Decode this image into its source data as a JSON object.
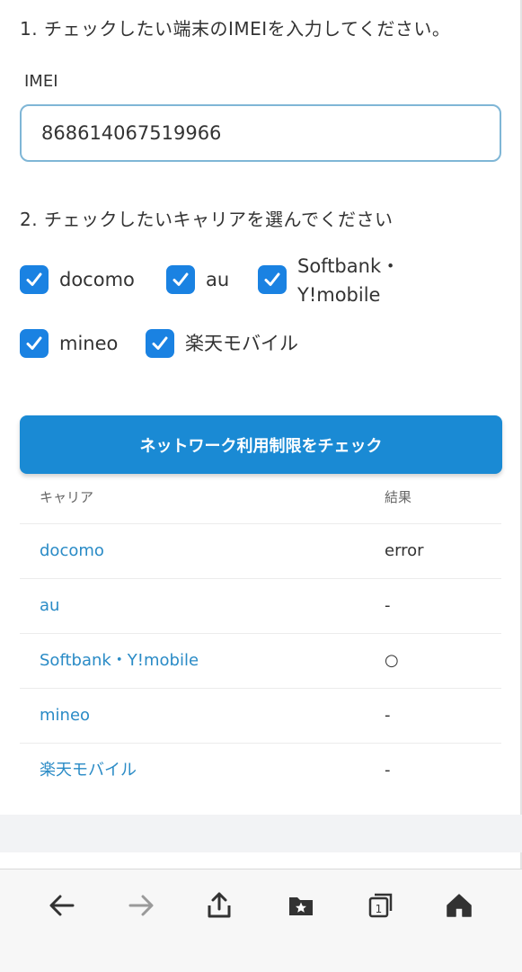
{
  "step1": "1. チェックしたい端末のIMEIを入力してください。",
  "imei": {
    "label": "IMEI",
    "value": "868614067519966"
  },
  "step2": "2. チェックしたいキャリアを選んでください",
  "carriers": {
    "docomo": "docomo",
    "au": "au",
    "softbank_line1": "Softbank・",
    "softbank_line2": "Y!mobile",
    "mineo": "mineo",
    "rakuten": "楽天モバイル"
  },
  "check_button": "ネットワーク利用制限をチェック",
  "table": {
    "header": {
      "carrier": "キャリア",
      "result": "結果"
    },
    "rows": [
      {
        "carrier": "docomo",
        "result": "error"
      },
      {
        "carrier": "au",
        "result": "-"
      },
      {
        "carrier": "Softbank・Y!mobile",
        "result": "○"
      },
      {
        "carrier": "mineo",
        "result": "-"
      },
      {
        "carrier": "楽天モバイル",
        "result": "-"
      }
    ]
  },
  "colors": {
    "accent": "#1a82e2",
    "button": "#1a8ad4",
    "link": "#2a8bc6"
  },
  "toolbar_icons": [
    "back-arrow-icon",
    "forward-arrow-icon",
    "share-icon",
    "bookmarks-icon",
    "tabs-icon",
    "home-icon"
  ],
  "tab_count": "1"
}
